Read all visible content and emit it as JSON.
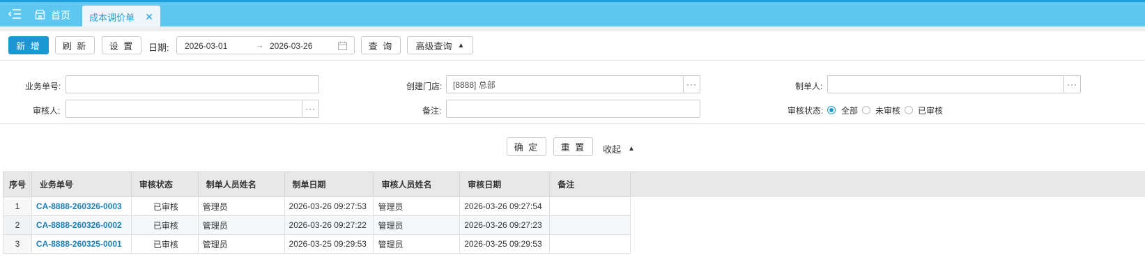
{
  "tabs": {
    "home_label": "首页",
    "active_label": "成本调价单",
    "close_glyph": "✕"
  },
  "toolbar": {
    "add_label": "新 增",
    "refresh_label": "刷 新",
    "settings_label": "设 置",
    "date_label": "日期:",
    "date_from": "2026-03-01",
    "date_arrow": "→",
    "date_to": "2026-03-26",
    "query_label": "查 询",
    "advanced_label": "高级查询",
    "advanced_arrow": "▲"
  },
  "filters": {
    "bill_no_label": "业务单号:",
    "bill_no_value": "",
    "store_label": "创建门店:",
    "store_value": "[8888] 总部",
    "maker_label": "制单人:",
    "maker_value": "",
    "reviewer_label": "审核人:",
    "reviewer_value": "",
    "remark_label": "备注:",
    "remark_value": "",
    "status_label": "审核状态:",
    "status_options": [
      "全部",
      "未审核",
      "已审核"
    ],
    "status_selected": "全部",
    "lookup_glyph": "···"
  },
  "actions": {
    "confirm_label": "确 定",
    "reset_label": "重 置",
    "collapse_label": "收起",
    "collapse_arrow": "▲"
  },
  "table": {
    "columns": [
      "序号",
      "业务单号",
      "审核状态",
      "制单人员姓名",
      "制单日期",
      "审核人员姓名",
      "审核日期",
      "备注"
    ],
    "rows": [
      {
        "seq": "1",
        "bill_no": "CA-8888-260326-0003",
        "status": "已审核",
        "maker": "管理员",
        "made_at": "2026-03-26 09:27:53",
        "reviewer": "管理员",
        "reviewed_at": "2026-03-26 09:27:54",
        "remark": ""
      },
      {
        "seq": "2",
        "bill_no": "CA-8888-260326-0002",
        "status": "已审核",
        "maker": "管理员",
        "made_at": "2026-03-26 09:27:22",
        "reviewer": "管理员",
        "reviewed_at": "2026-03-26 09:27:23",
        "remark": ""
      },
      {
        "seq": "3",
        "bill_no": "CA-8888-260325-0001",
        "status": "已审核",
        "maker": "管理员",
        "made_at": "2026-03-25 09:29:53",
        "reviewer": "管理员",
        "reviewed_at": "2026-03-25 09:29:53",
        "remark": ""
      }
    ]
  },
  "colors": {
    "topbar": "#5ec7f0",
    "primary": "#1e96d3",
    "link": "#1e7fb8"
  }
}
